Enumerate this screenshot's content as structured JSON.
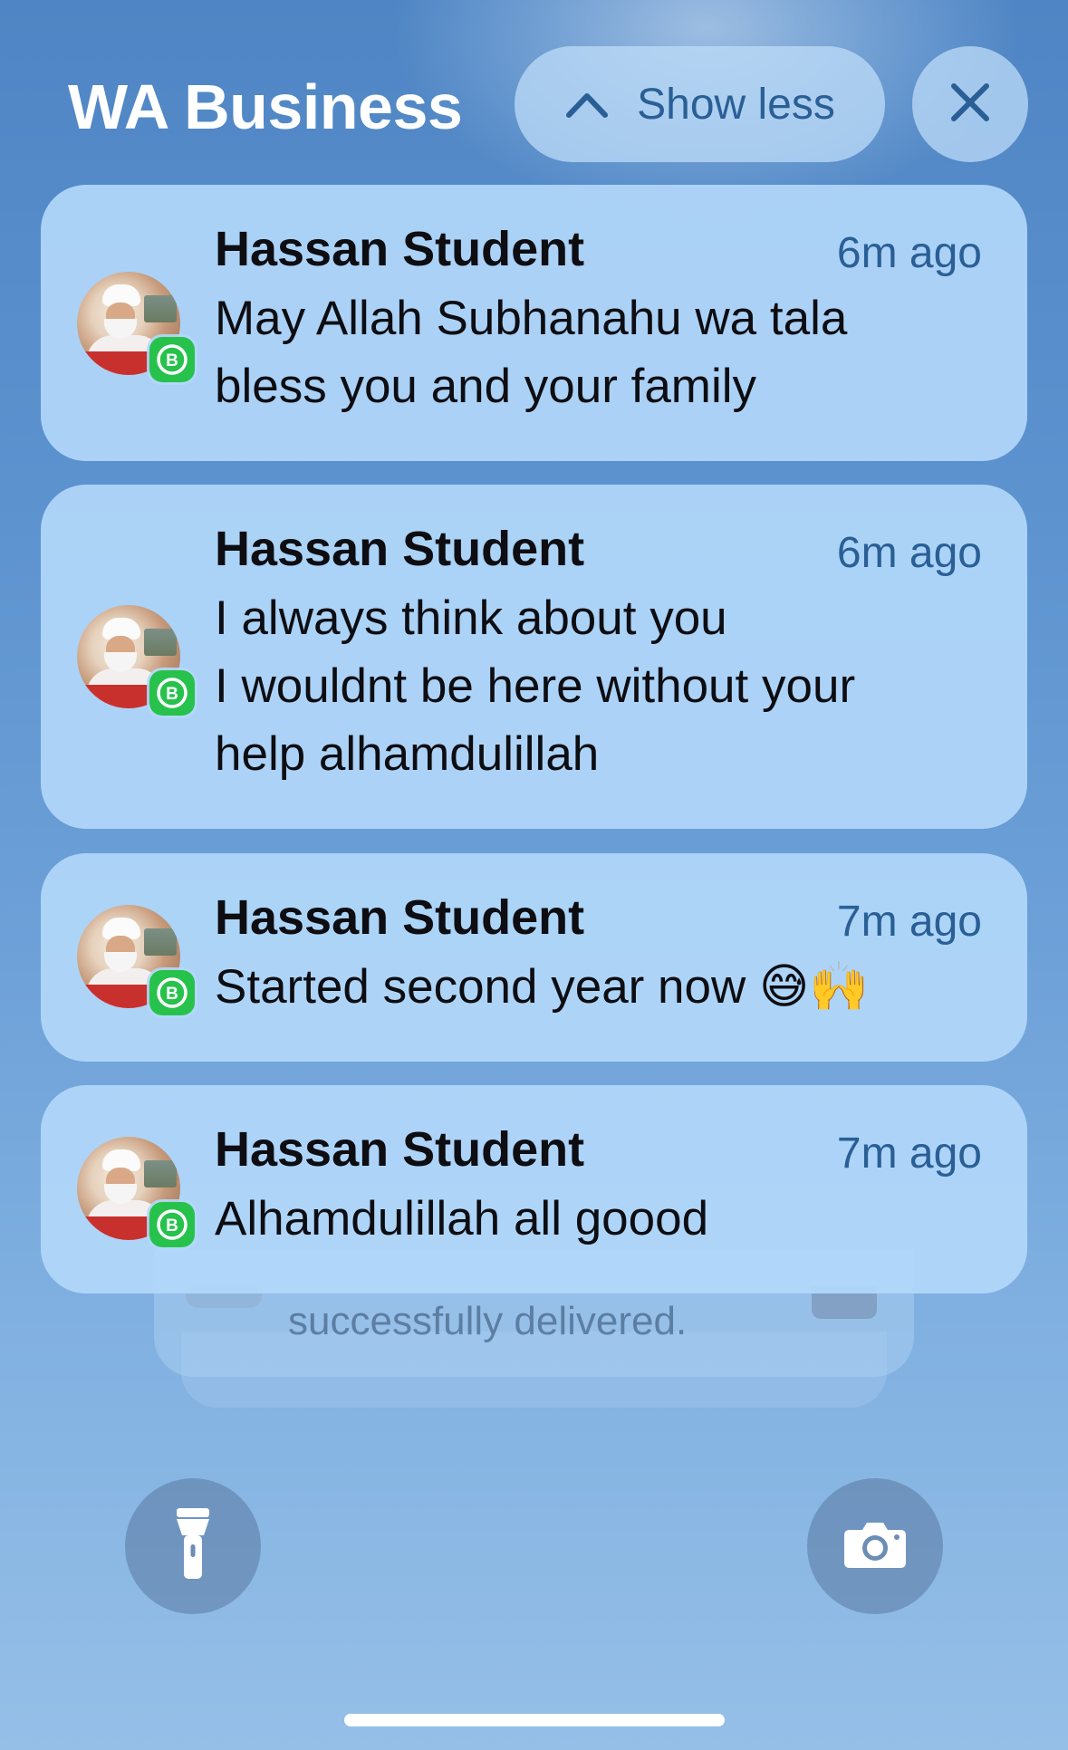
{
  "header": {
    "app_title": "WA Business",
    "show_less_label": "Show less",
    "show_less_icon": "chevron-up-icon",
    "close_icon": "close-icon"
  },
  "notifications": [
    {
      "sender": "Hassan Student",
      "time": "6m ago",
      "message": "May Allah Subhanahu wa tala\nbless you and your family"
    },
    {
      "sender": "Hassan Student",
      "time": "6m ago",
      "message": "I always think about you\nI wouldnt be here without your\nhelp alhamdulillah"
    },
    {
      "sender": "Hassan Student",
      "time": "7m ago",
      "message": "Started second year now 😅🙌"
    },
    {
      "sender": "Hassan Student",
      "time": "7m ago",
      "message": "Alhamdulillah all goood"
    }
  ],
  "stacked_notification": {
    "text": "successfully delivered."
  },
  "quick_actions": {
    "flashlight_icon": "flashlight-icon",
    "camera_icon": "camera-icon"
  },
  "colors": {
    "accent": "#2a5f96",
    "card_bg": "#b2d8fa",
    "badge_green": "#27c24c"
  }
}
